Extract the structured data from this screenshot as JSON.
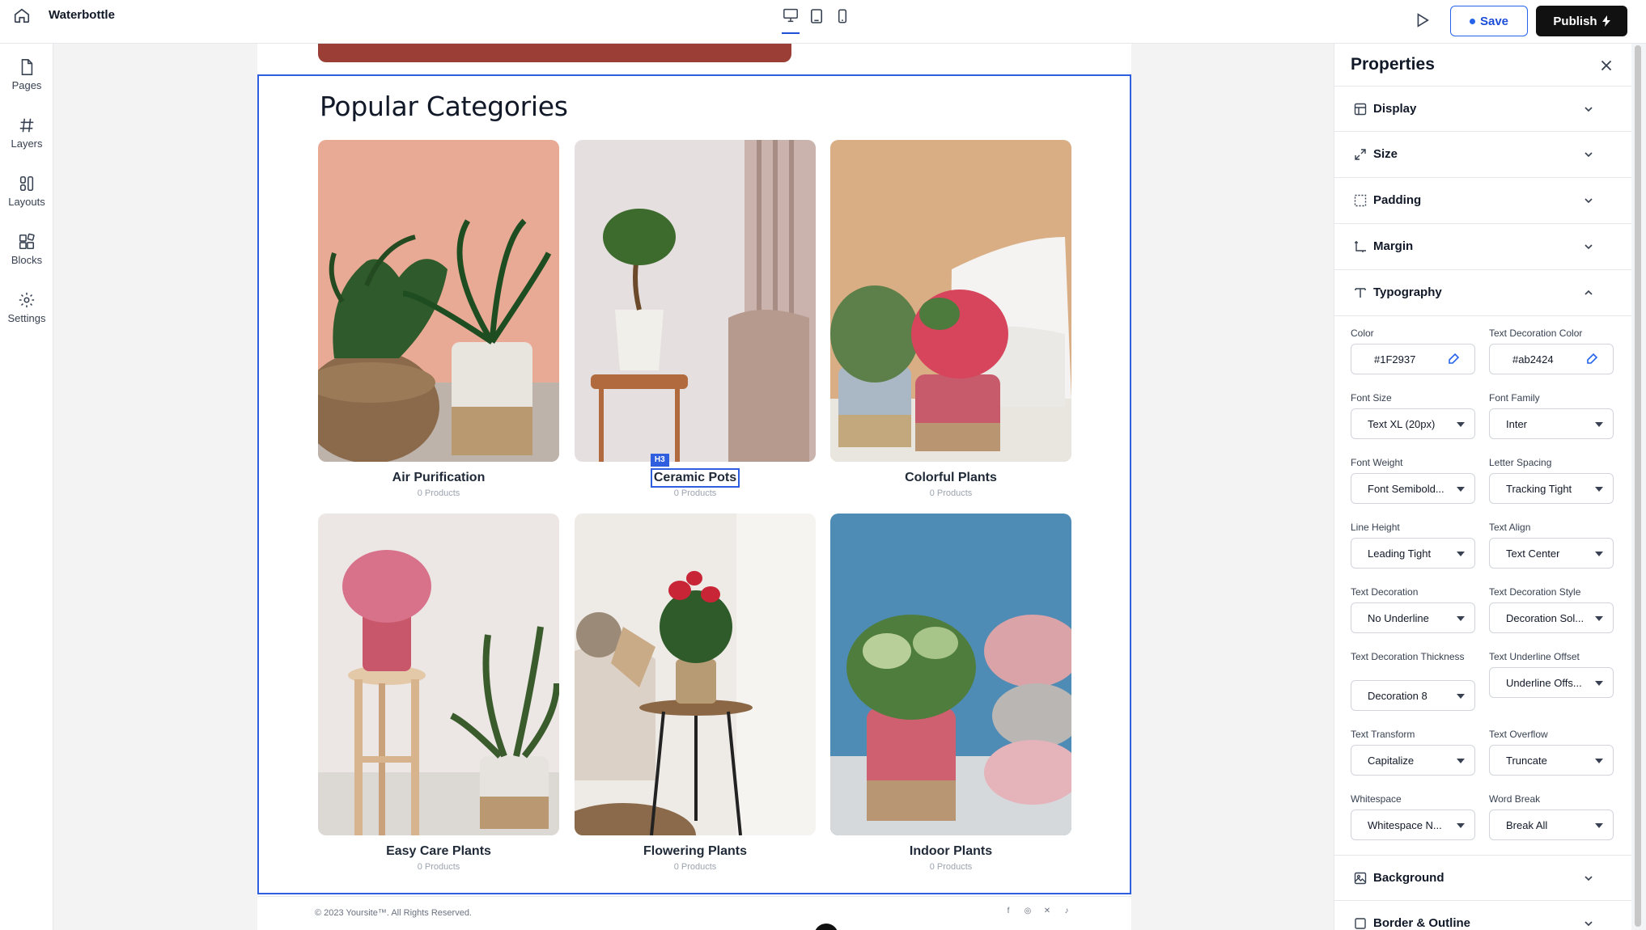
{
  "topbar": {
    "site_name": "Waterbottle",
    "save_label": "Save",
    "publish_label": "Publish"
  },
  "leftrail": {
    "items": [
      {
        "label": "Pages",
        "icon": "file-icon"
      },
      {
        "label": "Layers",
        "icon": "hash-icon"
      },
      {
        "label": "Layouts",
        "icon": "layouts-icon"
      },
      {
        "label": "Blocks",
        "icon": "blocks-icon"
      },
      {
        "label": "Settings",
        "icon": "gear-icon"
      }
    ]
  },
  "canvas": {
    "section_title": "Popular Categories",
    "selected_tag": "H3",
    "categories": [
      {
        "name": "Air Purification",
        "count": "0 Products"
      },
      {
        "name": "Ceramic Pots",
        "count": "0 Products"
      },
      {
        "name": "Colorful Plants",
        "count": "0 Products"
      },
      {
        "name": "Easy Care Plants",
        "count": "0 Products"
      },
      {
        "name": "Flowering Plants",
        "count": "0 Products"
      },
      {
        "name": "Indoor Plants",
        "count": "0 Products"
      }
    ],
    "footer_copy": "© 2023 Yoursite™. All Rights Reserved.",
    "social_icons": [
      "facebook-icon",
      "instagram-icon",
      "x-icon",
      "tiktok-icon"
    ]
  },
  "panel": {
    "title": "Properties",
    "sections": {
      "display": "Display",
      "size": "Size",
      "padding": "Padding",
      "margin": "Margin",
      "typography": "Typography",
      "background": "Background",
      "border": "Border & Outline"
    },
    "fields": {
      "color_label": "Color",
      "color_value": "#1F2937",
      "tdcolor_label": "Text Decoration Color",
      "tdcolor_value": "#ab2424",
      "font_size_label": "Font Size",
      "font_size_value": "Text XL (20px)",
      "font_family_label": "Font Family",
      "font_family_value": "Inter",
      "font_weight_label": "Font Weight",
      "font_weight_value": "Font Semibold...",
      "letter_spacing_label": "Letter Spacing",
      "letter_spacing_value": "Tracking Tight",
      "line_height_label": "Line Height",
      "line_height_value": "Leading Tight",
      "text_align_label": "Text Align",
      "text_align_value": "Text Center",
      "text_decoration_label": "Text Decoration",
      "text_decoration_value": "No Underline",
      "td_style_label": "Text Decoration Style",
      "td_style_value": "Decoration Sol...",
      "td_thickness_label": "Text Decoration Thickness",
      "td_thickness_value": "Decoration 8",
      "underline_offset_label": "Text Underline Offset",
      "underline_offset_value": "Underline Offs...",
      "text_transform_label": "Text Transform",
      "text_transform_value": "Capitalize",
      "text_overflow_label": "Text Overflow",
      "text_overflow_value": "Truncate",
      "whitespace_label": "Whitespace",
      "whitespace_value": "Whitespace N...",
      "word_break_label": "Word Break",
      "word_break_value": "Break All"
    }
  },
  "colors": {
    "accent": "#2f5fde",
    "hero_strip": "#9b3f36",
    "publish_bg": "#111111"
  }
}
